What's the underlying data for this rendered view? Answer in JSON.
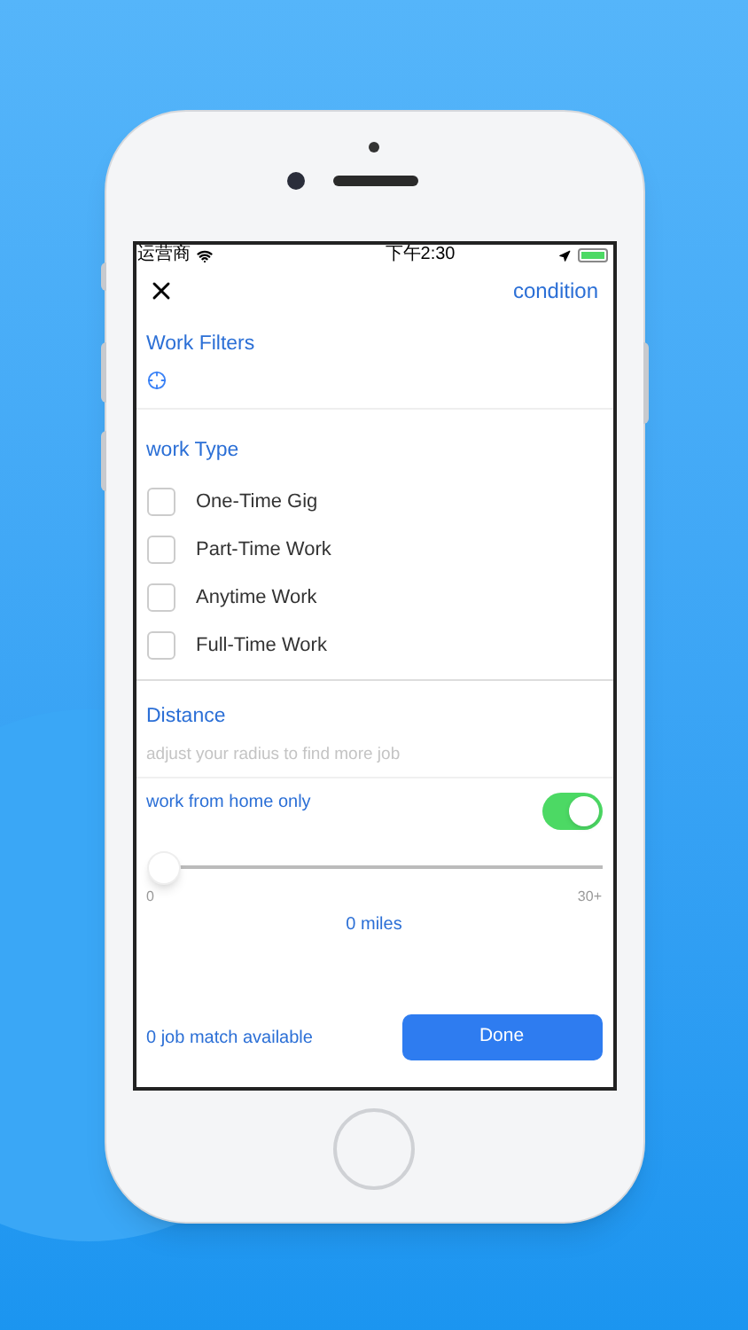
{
  "status_bar": {
    "carrier": "运营商",
    "time": "下午2:30"
  },
  "header": {
    "action": "condition"
  },
  "filters": {
    "title": "Work Filters"
  },
  "work_type": {
    "title": "work Type",
    "options": [
      {
        "label": "One-Time Gig",
        "checked": false
      },
      {
        "label": "Part-Time Work",
        "checked": false
      },
      {
        "label": "Anytime Work",
        "checked": false
      },
      {
        "label": "Full-Time Work",
        "checked": false
      }
    ]
  },
  "distance": {
    "title": "Distance",
    "hint": "adjust your radius to find more job"
  },
  "work_from_home": {
    "label": "work from home only",
    "on": true
  },
  "slider": {
    "level": 0,
    "min": "0",
    "max": "30+",
    "reading": "0 miles"
  },
  "footer": {
    "matches": "0 job match available",
    "button": "Done"
  }
}
